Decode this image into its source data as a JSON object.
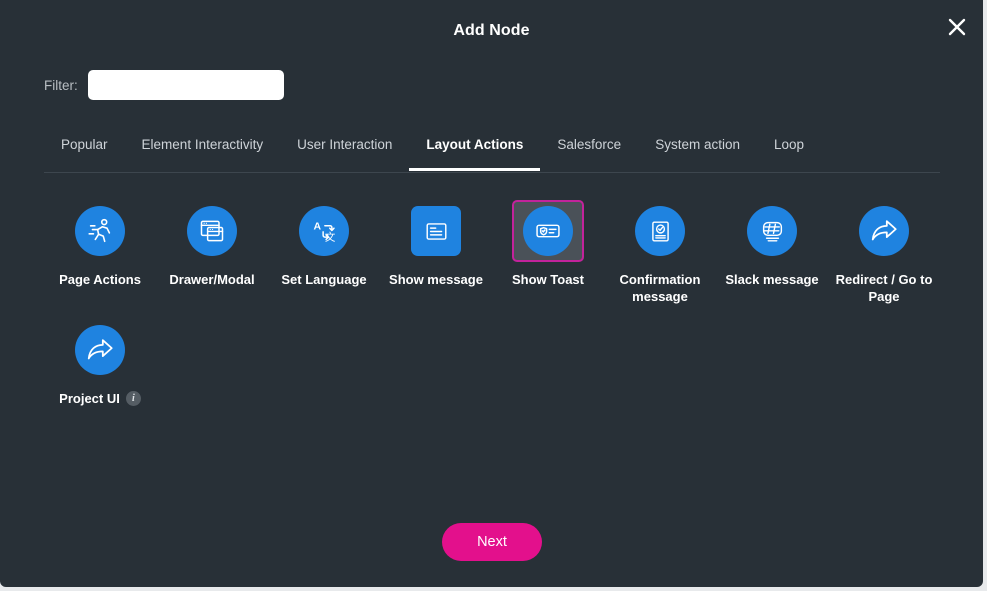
{
  "modal": {
    "title": "Add Node",
    "close_icon": "close-icon",
    "background_color": "#283037"
  },
  "filter": {
    "label": "Filter:",
    "value": "",
    "placeholder": ""
  },
  "tabs": [
    {
      "label": "Popular",
      "active": false
    },
    {
      "label": "Element Interactivity",
      "active": false
    },
    {
      "label": "User Interaction",
      "active": false
    },
    {
      "label": "Layout Actions",
      "active": true
    },
    {
      "label": "Salesforce",
      "active": false
    },
    {
      "label": "System action",
      "active": false
    },
    {
      "label": "Loop",
      "active": false
    }
  ],
  "nodes": [
    {
      "label": "Page Actions",
      "icon": "running-person-icon",
      "shape": "circle",
      "selected": false,
      "badge": ""
    },
    {
      "label": "Drawer/Modal",
      "icon": "windows-stack-icon",
      "shape": "circle",
      "selected": false,
      "badge": ""
    },
    {
      "label": "Set Language",
      "icon": "translate-icon",
      "shape": "circle",
      "selected": false,
      "badge": ""
    },
    {
      "label": "Show message",
      "icon": "message-lines-icon",
      "shape": "square",
      "selected": false,
      "badge": ""
    },
    {
      "label": "Show Toast",
      "icon": "toast-shield-icon",
      "shape": "circle",
      "selected": true,
      "badge": ""
    },
    {
      "label": "Confirmation message",
      "icon": "confirmation-check-icon",
      "shape": "circle",
      "selected": false,
      "badge": ""
    },
    {
      "label": "Slack message",
      "icon": "slack-hash-icon",
      "shape": "circle",
      "selected": false,
      "badge": ""
    },
    {
      "label": "Redirect / Go to Page",
      "icon": "curved-arrow-icon",
      "shape": "circle",
      "selected": false,
      "badge": ""
    },
    {
      "label": "Project UI",
      "icon": "curved-arrow-icon",
      "shape": "circle",
      "selected": false,
      "badge": "i"
    }
  ],
  "footer": {
    "next_label": "Next",
    "next_color": "#e3108c"
  },
  "colors": {
    "accent_blue": "#1f83e0",
    "selection_magenta": "#c2239b",
    "panel": "#283037"
  }
}
